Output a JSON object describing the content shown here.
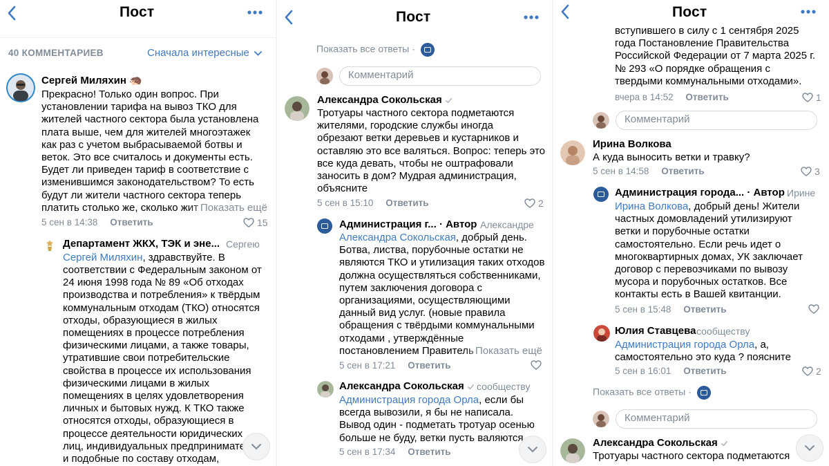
{
  "colors": {
    "accent": "#3f7ac2",
    "secondary": "#818c99",
    "divider": "#f2f3f5"
  },
  "header": {
    "title": "Пост"
  },
  "p1": {
    "count_label": "40 КОММЕНТАРИЕВ",
    "sort_label": "Сначала интересные",
    "c1": {
      "author": "Сергей Миляхин",
      "author_emoji": "🦔",
      "lines": [
        "Прекрасно! Только один вопрос. При",
        "установлении тарифа на вывоз ТКО для",
        "жителей частного сектора была установлена",
        "плата выше, чем для жителей многоэтажек",
        "как раз с учетом выбрасываемой ботвы и",
        "веток. Это все считалось и документы есть.",
        "Будет ли приведен тариф в соответствие с",
        "изменившимся законодательством? То есть",
        "будут ли жители частного сектора теперь",
        "платить столько же, сколько жит"
      ],
      "show_more": "Показать ещё",
      "time": "5 сен в 14:38",
      "reply": "Ответить",
      "likes": "15"
    },
    "c2": {
      "author": "Департамент ЖКХ, ТЭК и эне...",
      "reply_to": "Сергею",
      "mention": "Сергей Миляхин",
      "first_line_rest": ", здравствуйте.  В",
      "lines": [
        "соответствии с Федеральным законом от",
        "24 июня 1998 года № 89 «Об отходах",
        "производства и потребления» к твёрдым",
        "коммунальным отходам (ТКО) относятся",
        "отходы, образующиеся в жилых",
        "помещениях в процессе потребления",
        "физическими лицами, а также товары,",
        "утратившие свои потребительские",
        "свойства в процессе их использования",
        "физическими лицами в жилых",
        "помещениях в целях удовлетворения",
        "личных и бытовых нужд. К ТКО также",
        "относятся отходы, образующиеся в",
        "процессе деятельности юридических",
        "лиц, индивидуальных предпринимате",
        "и подобные по составу отходам,"
      ]
    }
  },
  "p2": {
    "show_all": "Показать все ответы ·",
    "comment_placeholder": "Комментарий",
    "c1": {
      "author": "Александра Сокольская",
      "lines": [
        "Тротуары частного сектора подметаются",
        "жителями, городские службы иногда",
        "обрезают ветки деревьев и кустарников и",
        "оставляю это все валяться. Вопрос: теперь это",
        "все куда девать, чтобы не оштрафовали",
        "заносить в дом? Мудрая администрация,",
        "объясните"
      ],
      "time": "5 сен в 15:10",
      "reply": "Ответить",
      "likes": "2"
    },
    "c2": {
      "author": "Администрация г...",
      "author_tag": "· Автор",
      "reply_to": "Александре",
      "mention": "Александра Сокольская",
      "first_line_rest": ", добрый день.",
      "lines": [
        "Ботва, листва, порубочные остатки не",
        "являются ТКО и утилизация таких отходов",
        "должна осуществляться собственниками,",
        "путем заключения договора с",
        "организациями, осуществляющими",
        "данный вид услуг. (новые правила",
        "обращения с твёрдыми коммунальными",
        "отходами , утверждённые",
        "постановлением Правитель"
      ],
      "show_more": "Показать ещё",
      "time": "5 сен в 17:21",
      "reply": "Ответить"
    },
    "c3": {
      "author": "Александра Сокольская",
      "reply_to": "сообществу",
      "mention": "Администрация города Орла",
      "first_line_rest": ", если бы",
      "lines": [
        "всегда вывозили, я бы не написала.",
        "Вывод один - подметать тротуар осенью",
        "больше не буду, ветки пусть валяются."
      ],
      "time": "5 сен в 17:34",
      "reply": "Ответить"
    }
  },
  "p3": {
    "c0": {
      "lines": [
        "вступившего в силу с 1 сентября 2025",
        "года Постановление Правительства",
        "Российской Федерации от 7 марта 2025 г.",
        "№ 293 «О порядке обращения с",
        "твердыми коммунальными отходами»."
      ],
      "time": "вчера в 14:52",
      "reply": "Ответить",
      "likes": "1"
    },
    "comment_placeholder": "Комментарий",
    "c1": {
      "author": "Ирина Волкова",
      "lines": [
        "А куда выносить ветки и травку?"
      ],
      "time": "5 сен в 14:58",
      "reply": "Ответить",
      "likes": "3"
    },
    "c2": {
      "author": "Администрация города...",
      "author_tag": "· Автор",
      "reply_to": "Ирине",
      "mention": "Ирина Волкова",
      "first_line_rest": ", добрый день! Жители",
      "lines": [
        "частных домовладений утилизируют",
        "ветки и порубочные остатки",
        "самостоятельно. Если речь идет о",
        "многоквартирных домах, УК заключает",
        "договор с перевозчиками по вывозу",
        "мусора и порубочных остатков. Все",
        "контакты есть в Вашей квитанции."
      ],
      "time": "5 сен в 15:48",
      "reply": "Ответить"
    },
    "c3": {
      "author": "Юлия Ставцева",
      "reply_to": "сообществу",
      "mention": "Администрация города Орла",
      "first_line_rest": ",  а,",
      "lines": [
        "самостоятельно это куда ? поясните"
      ],
      "time": "5 сен в 16:01",
      "reply": "Ответить",
      "likes": "2"
    },
    "show_all": "Показать все ответы ·",
    "c4": {
      "author": "Александра Сокольская",
      "lines": [
        "Тротуары частного сектора подметаются"
      ]
    }
  }
}
